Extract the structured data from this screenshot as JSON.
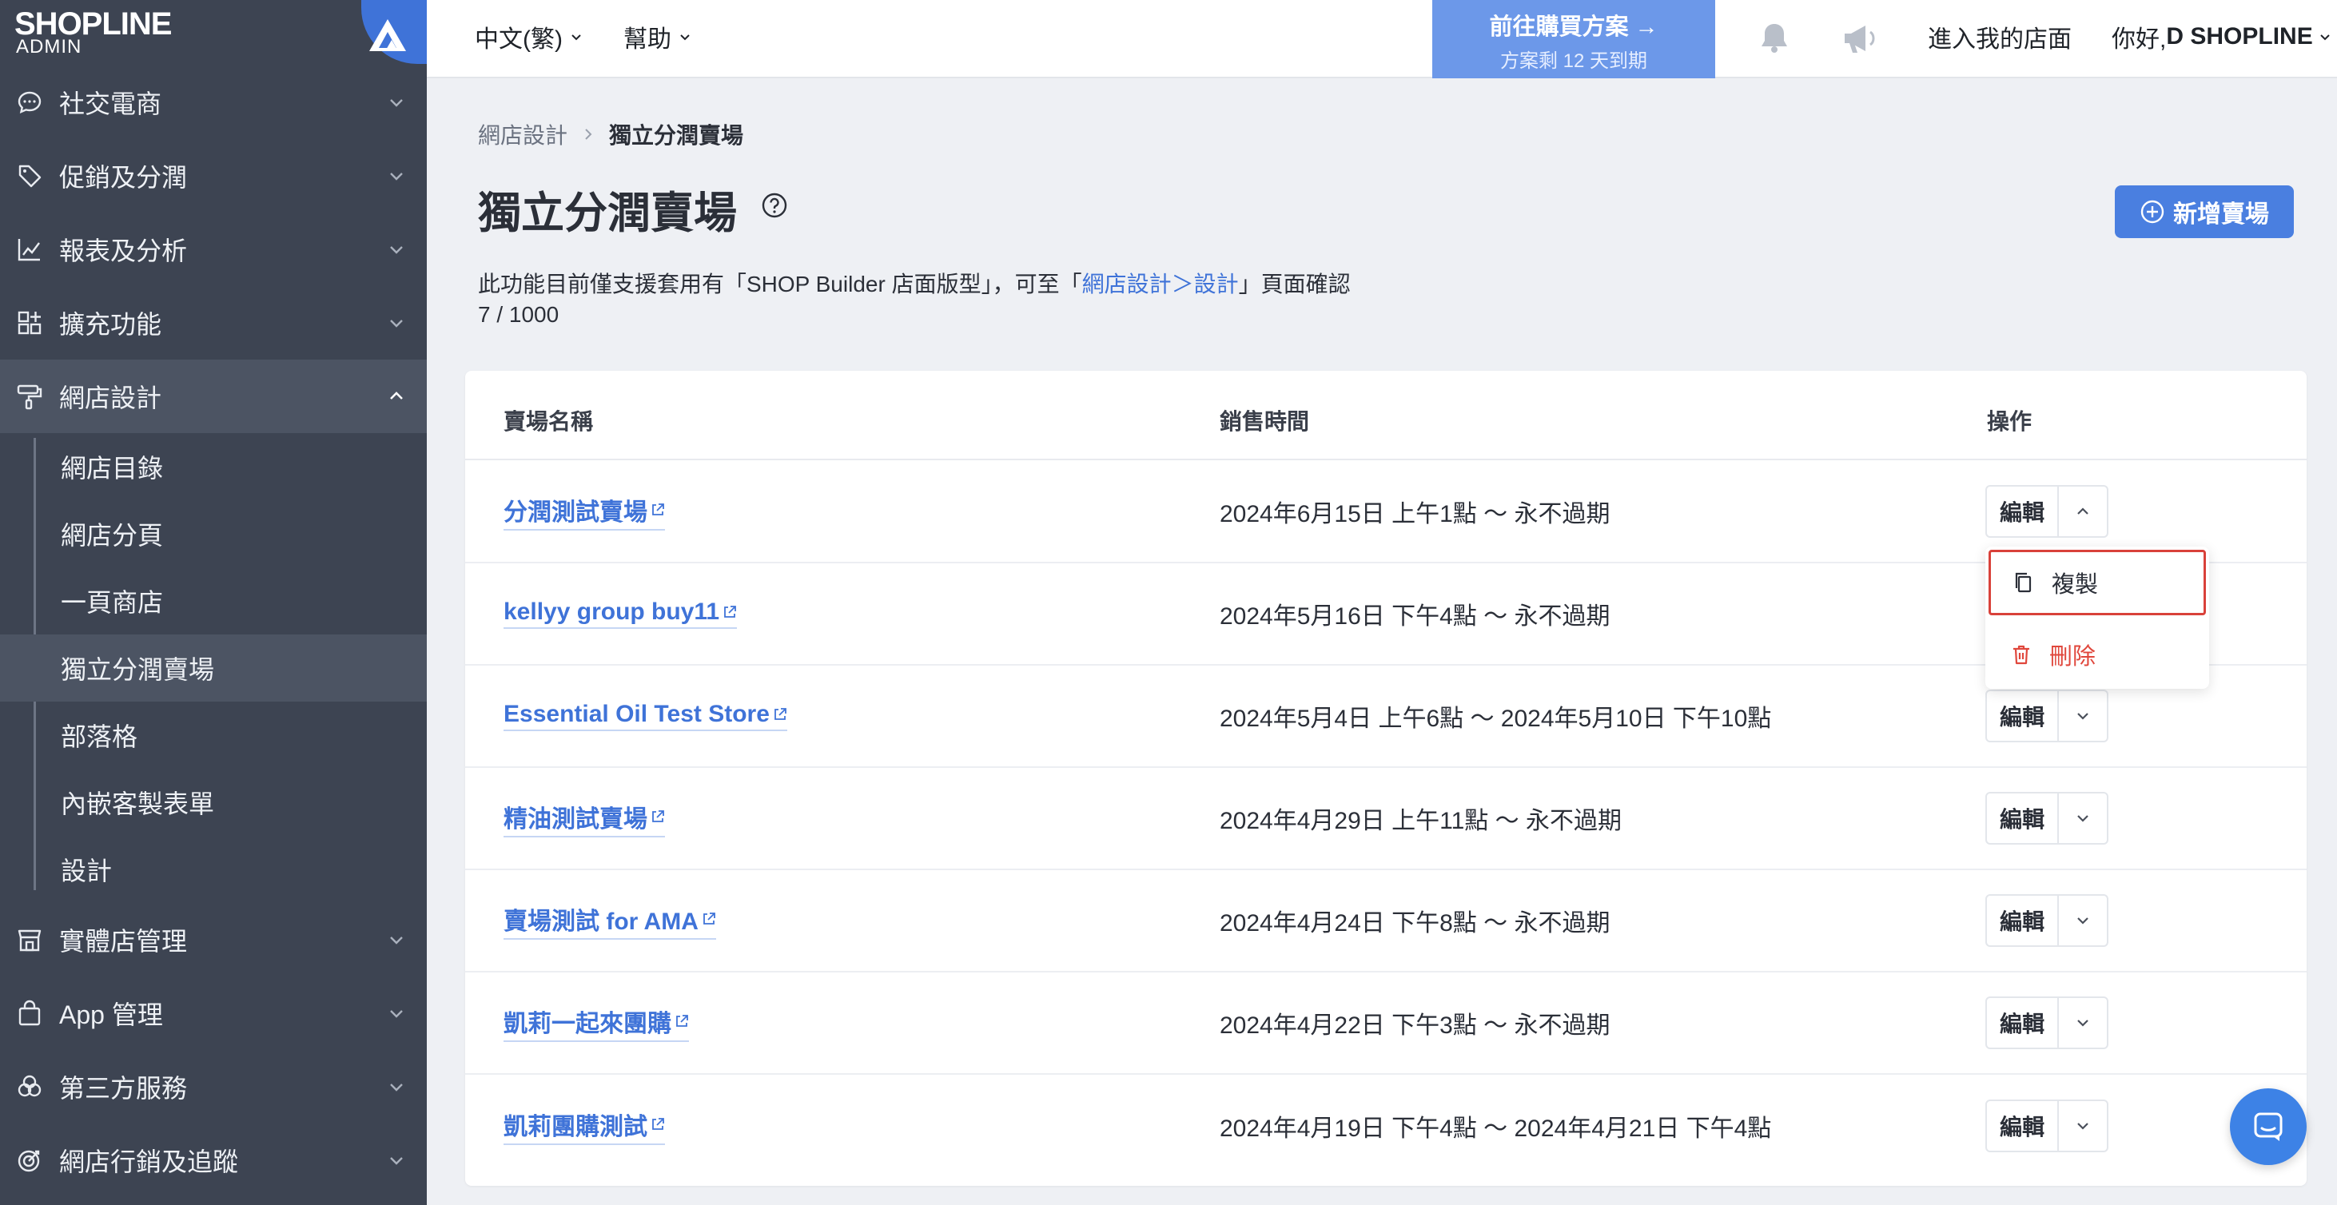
{
  "brand": {
    "name": "SHOPLINE",
    "sub": "ADMIN"
  },
  "sidebar": {
    "items": [
      {
        "label": "社交電商",
        "icon": "chat-bubble-icon"
      },
      {
        "label": "促銷及分潤",
        "icon": "tag-icon"
      },
      {
        "label": "報表及分析",
        "icon": "chart-icon"
      },
      {
        "label": "擴充功能",
        "icon": "apps-icon"
      },
      {
        "label": "網店設計",
        "icon": "paint-roller-icon"
      },
      {
        "label": "實體店管理",
        "icon": "store-icon"
      },
      {
        "label": "App 管理",
        "icon": "bag-icon"
      },
      {
        "label": "第三方服務",
        "icon": "circles-icon"
      },
      {
        "label": "網店行銷及追蹤",
        "icon": "target-icon"
      }
    ],
    "sub_items": [
      "網店目錄",
      "網店分頁",
      "一頁商店",
      "獨立分潤賣場",
      "部落格",
      "內嵌客製表單",
      "設計"
    ]
  },
  "topbar": {
    "language": "中文(繁)",
    "help": "幫助",
    "promo_title": "前往購買方案 →",
    "promo_sub": "方案剩 12 天到期",
    "store_link": "進入我的店面",
    "greeting": "你好, ",
    "user": "D SHOPLINE"
  },
  "page": {
    "breadcrumb_parent": "網店設計",
    "breadcrumb_current": "獨立分潤賣場",
    "title": "獨立分潤賣場",
    "add_button": "新增賣場",
    "notice_prefix": "此功能目前僅支援套用有「SHOP Builder 店面版型」，可至「",
    "notice_link": "網店設計＞設計",
    "notice_suffix": "」頁面確認",
    "count": "7 / 1000"
  },
  "table": {
    "headers": {
      "name": "賣場名稱",
      "time": "銷售時間",
      "action": "操作"
    },
    "edit_label": "編輯",
    "rows": [
      {
        "name": "分潤測試賣場",
        "time": "2024年6月15日 上午1點 ～ 永不過期"
      },
      {
        "name": "kellyy group buy11",
        "time": "2024年5月16日 下午4點 ～ 永不過期"
      },
      {
        "name": "Essential Oil Test Store",
        "time": "2024年5月4日 上午6點 ～ 2024年5月10日 下午10點"
      },
      {
        "name": "精油測試賣場",
        "time": "2024年4月29日 上午11點 ～ 永不過期"
      },
      {
        "name": "賣場測試 for AMA",
        "time": "2024年4月24日 下午8點 ～ 永不過期"
      },
      {
        "name": "凱莉一起來團購",
        "time": "2024年4月22日 下午3點 ～ 永不過期"
      },
      {
        "name": "凱莉團購測試",
        "time": "2024年4月19日 下午4點 ～ 2024年4月21日 下午4點"
      }
    ]
  },
  "dropdown": {
    "copy": "複製",
    "delete": "刪除"
  },
  "colors": {
    "accent": "#4a7fe0",
    "sidebar": "#3d4452",
    "danger": "#e0473c",
    "highlight_border": "#d9413a"
  }
}
